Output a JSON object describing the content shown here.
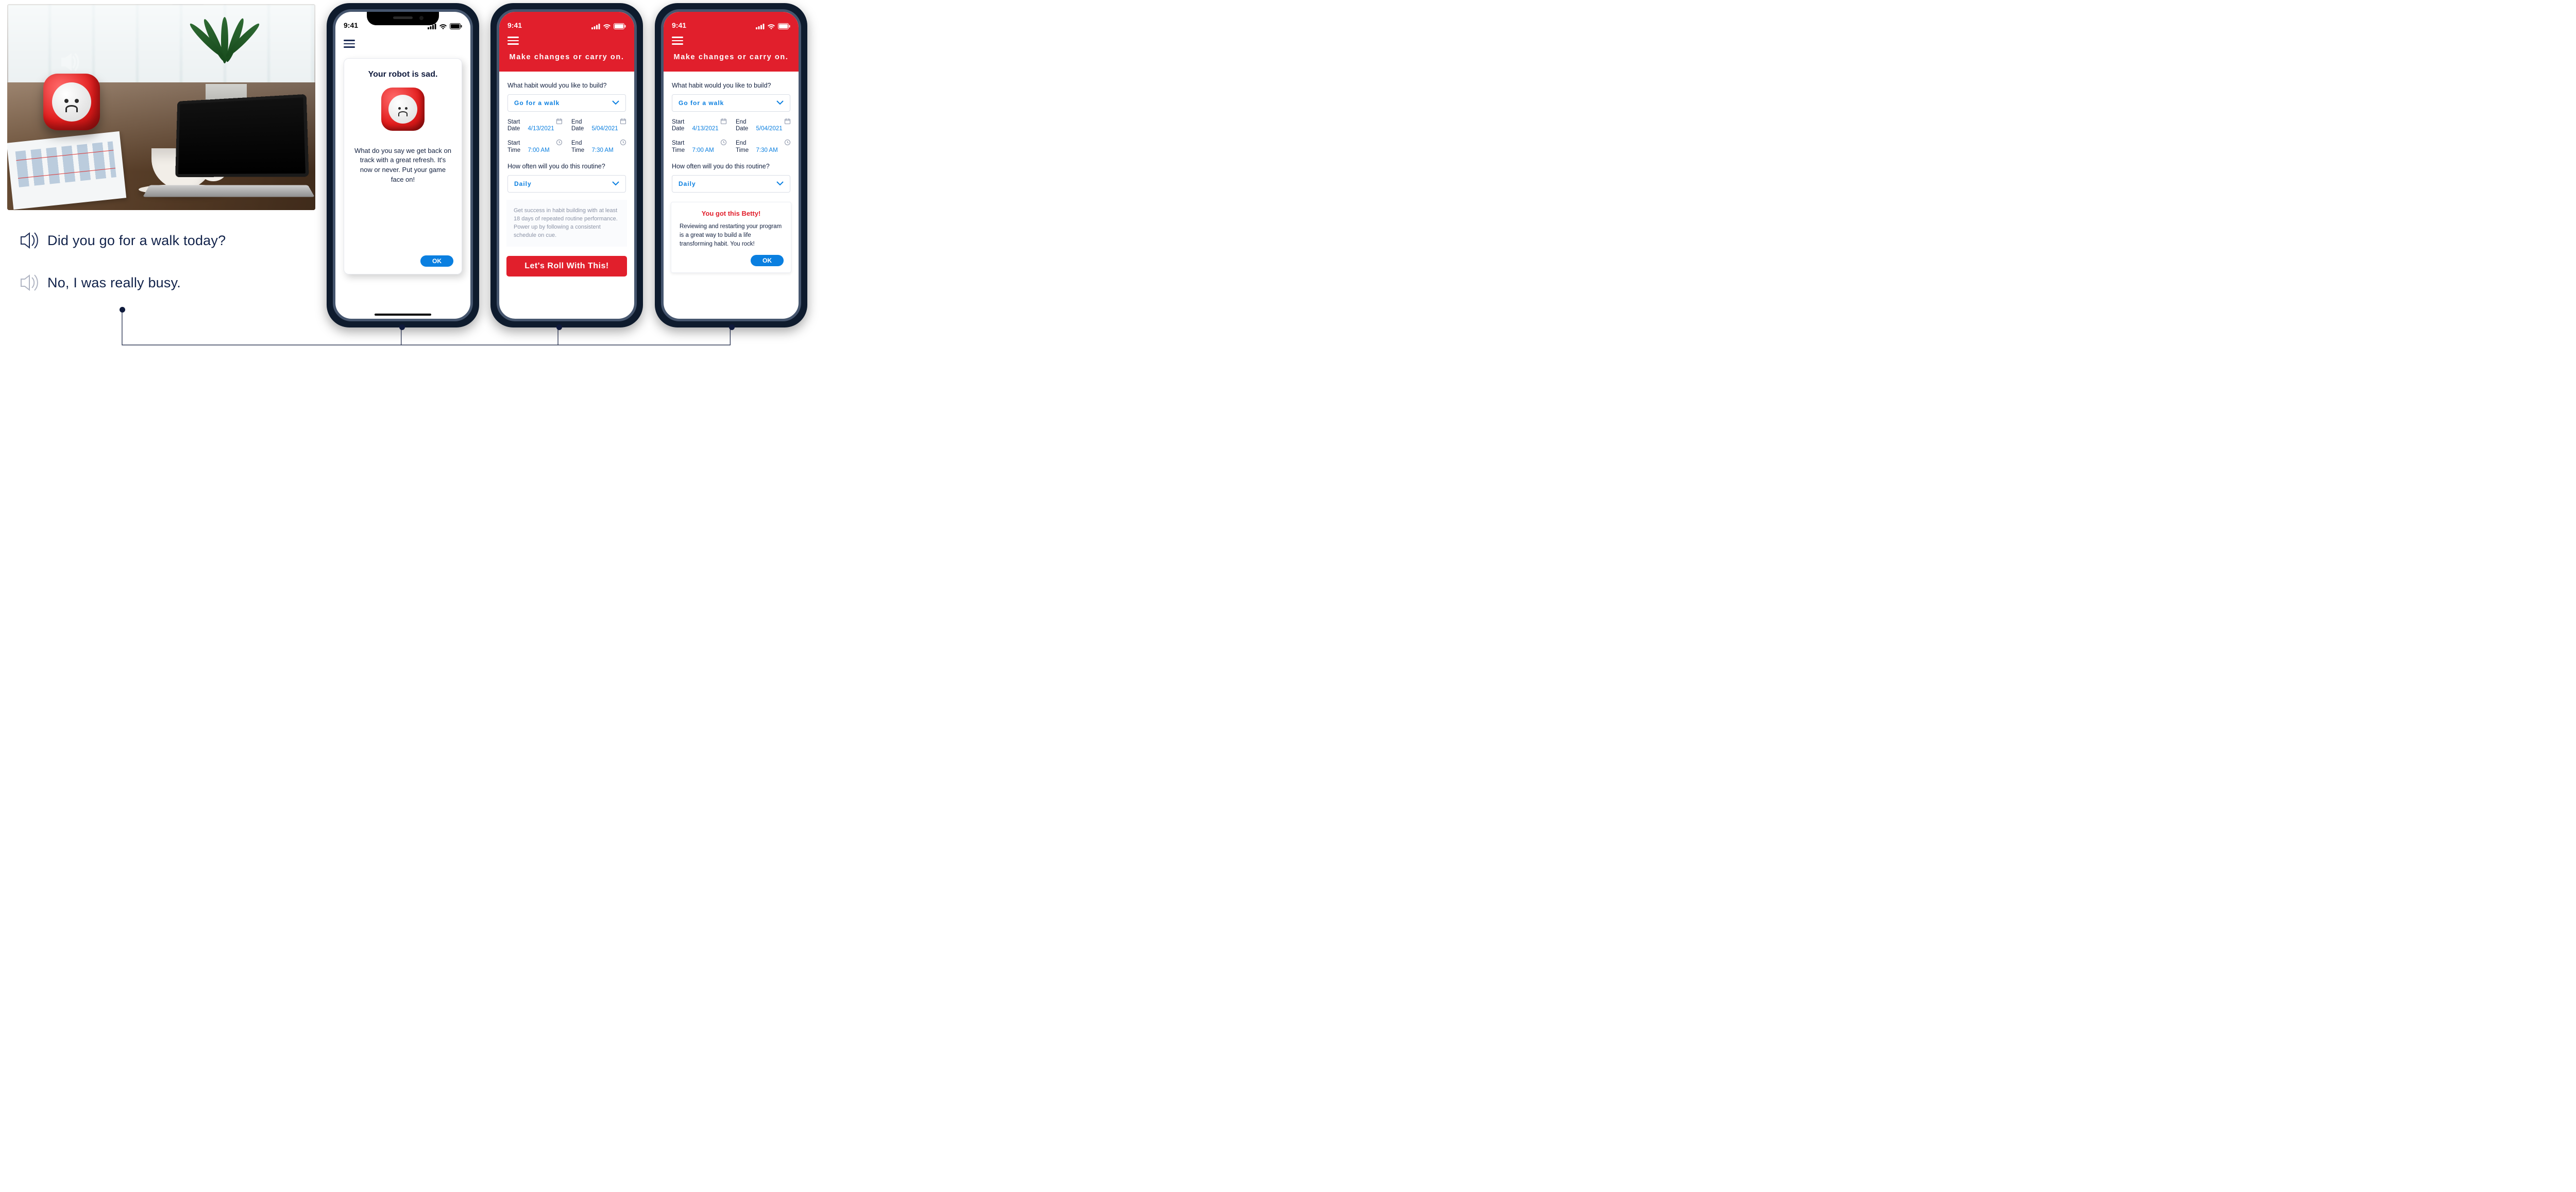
{
  "status": {
    "time": "9:41"
  },
  "conversation": {
    "q": "Did you go for a walk today?",
    "a": "No, I was really busy."
  },
  "phone1": {
    "card_title": "Your robot is sad.",
    "card_body": "What do you say we get back on track with a great refresh. It's now or never. Put your game face on!",
    "ok": "OK"
  },
  "habitForm": {
    "header_title": "Make changes or carry on.",
    "q_habit": "What habit would you like to build?",
    "habit_value": "Go for a walk",
    "start_date_label": "Start Date",
    "start_date": "4/13/2021",
    "end_date_label": "End Date",
    "end_date": "5/04/2021",
    "start_time_label": "Start Time",
    "start_time": "7:00 AM",
    "end_time_label": "End Time",
    "end_time": "7:30 AM",
    "q_freq": "How often will you do this routine?",
    "freq_value": "Daily"
  },
  "phone2": {
    "hint": "Get success in habit building with at least 18 days of repeated routine performance. Power up by following a consistent schedule on cue.",
    "cta": "Let's Roll With This!"
  },
  "phone3": {
    "toast_title": "You got this Betty!",
    "toast_body": "Reviewing and restarting your program is a great way to build a life transforming habit. You rock!",
    "ok": "OK"
  }
}
